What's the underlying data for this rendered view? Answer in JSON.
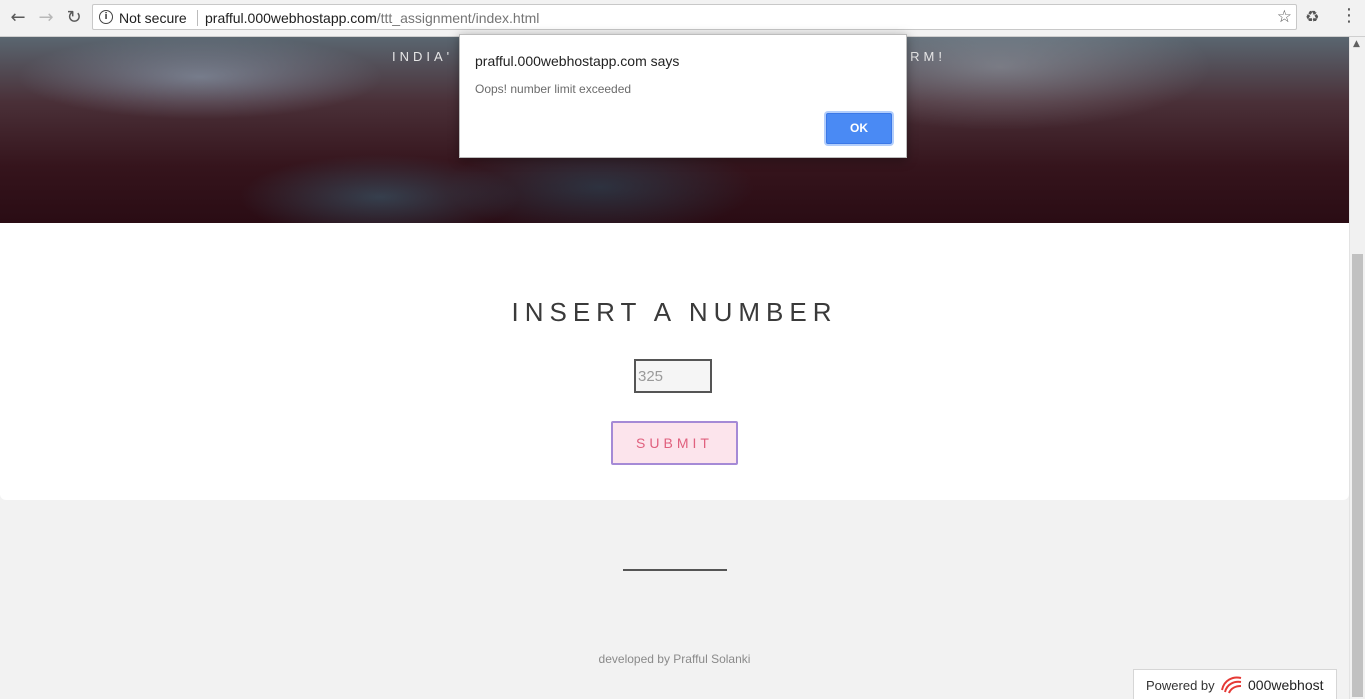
{
  "browser": {
    "security_label": "Not secure",
    "url_host": "prafful.000webhostapp.com",
    "url_path": "/ttt_assignment/index.html"
  },
  "hero": {
    "tagline_left": "INDIA'",
    "tagline_right": "ORM!"
  },
  "main": {
    "heading": "INSERT A NUMBER",
    "number_value": "325",
    "submit_label": "SUBMIT"
  },
  "footer": {
    "credit": "developed by Prafful Solanki"
  },
  "badge": {
    "powered_label": "Powered by",
    "brand": "000webhost"
  },
  "dialog": {
    "title": "prafful.000webhostapp.com says",
    "message": "Oops! number limit exceeded",
    "ok_label": "OK"
  },
  "colors": {
    "ok_button": "#4a8af4",
    "submit_bg": "#fce4ec",
    "submit_text": "#e0607e",
    "submit_border": "#a58ad6"
  },
  "icons": [
    "back-icon",
    "forward-icon",
    "reload-icon",
    "info-icon",
    "star-icon",
    "extension-icon",
    "menu-icon",
    "webhost-logo-icon"
  ]
}
